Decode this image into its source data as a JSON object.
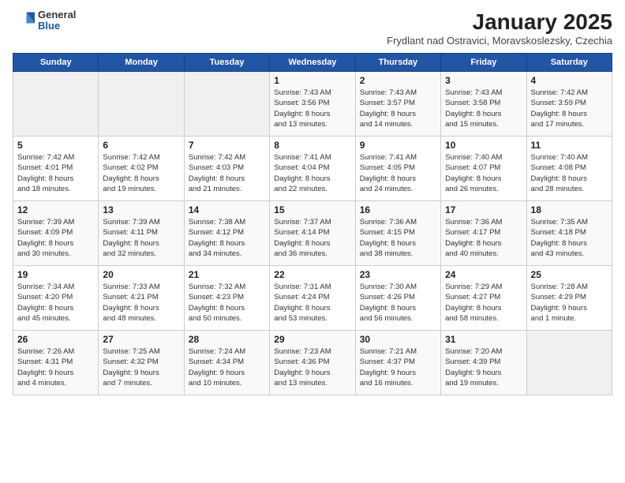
{
  "header": {
    "logo_general": "General",
    "logo_blue": "Blue",
    "month_title": "January 2025",
    "location": "Frydlant nad Ostravici, Moravskoslezsky, Czechia"
  },
  "weekdays": [
    "Sunday",
    "Monday",
    "Tuesday",
    "Wednesday",
    "Thursday",
    "Friday",
    "Saturday"
  ],
  "weeks": [
    [
      {
        "day": "",
        "info": ""
      },
      {
        "day": "",
        "info": ""
      },
      {
        "day": "",
        "info": ""
      },
      {
        "day": "1",
        "info": "Sunrise: 7:43 AM\nSunset: 3:56 PM\nDaylight: 8 hours\nand 13 minutes."
      },
      {
        "day": "2",
        "info": "Sunrise: 7:43 AM\nSunset: 3:57 PM\nDaylight: 8 hours\nand 14 minutes."
      },
      {
        "day": "3",
        "info": "Sunrise: 7:43 AM\nSunset: 3:58 PM\nDaylight: 8 hours\nand 15 minutes."
      },
      {
        "day": "4",
        "info": "Sunrise: 7:42 AM\nSunset: 3:59 PM\nDaylight: 8 hours\nand 17 minutes."
      }
    ],
    [
      {
        "day": "5",
        "info": "Sunrise: 7:42 AM\nSunset: 4:01 PM\nDaylight: 8 hours\nand 18 minutes."
      },
      {
        "day": "6",
        "info": "Sunrise: 7:42 AM\nSunset: 4:02 PM\nDaylight: 8 hours\nand 19 minutes."
      },
      {
        "day": "7",
        "info": "Sunrise: 7:42 AM\nSunset: 4:03 PM\nDaylight: 8 hours\nand 21 minutes."
      },
      {
        "day": "8",
        "info": "Sunrise: 7:41 AM\nSunset: 4:04 PM\nDaylight: 8 hours\nand 22 minutes."
      },
      {
        "day": "9",
        "info": "Sunrise: 7:41 AM\nSunset: 4:05 PM\nDaylight: 8 hours\nand 24 minutes."
      },
      {
        "day": "10",
        "info": "Sunrise: 7:40 AM\nSunset: 4:07 PM\nDaylight: 8 hours\nand 26 minutes."
      },
      {
        "day": "11",
        "info": "Sunrise: 7:40 AM\nSunset: 4:08 PM\nDaylight: 8 hours\nand 28 minutes."
      }
    ],
    [
      {
        "day": "12",
        "info": "Sunrise: 7:39 AM\nSunset: 4:09 PM\nDaylight: 8 hours\nand 30 minutes."
      },
      {
        "day": "13",
        "info": "Sunrise: 7:39 AM\nSunset: 4:11 PM\nDaylight: 8 hours\nand 32 minutes."
      },
      {
        "day": "14",
        "info": "Sunrise: 7:38 AM\nSunset: 4:12 PM\nDaylight: 8 hours\nand 34 minutes."
      },
      {
        "day": "15",
        "info": "Sunrise: 7:37 AM\nSunset: 4:14 PM\nDaylight: 8 hours\nand 36 minutes."
      },
      {
        "day": "16",
        "info": "Sunrise: 7:36 AM\nSunset: 4:15 PM\nDaylight: 8 hours\nand 38 minutes."
      },
      {
        "day": "17",
        "info": "Sunrise: 7:36 AM\nSunset: 4:17 PM\nDaylight: 8 hours\nand 40 minutes."
      },
      {
        "day": "18",
        "info": "Sunrise: 7:35 AM\nSunset: 4:18 PM\nDaylight: 8 hours\nand 43 minutes."
      }
    ],
    [
      {
        "day": "19",
        "info": "Sunrise: 7:34 AM\nSunset: 4:20 PM\nDaylight: 8 hours\nand 45 minutes."
      },
      {
        "day": "20",
        "info": "Sunrise: 7:33 AM\nSunset: 4:21 PM\nDaylight: 8 hours\nand 48 minutes."
      },
      {
        "day": "21",
        "info": "Sunrise: 7:32 AM\nSunset: 4:23 PM\nDaylight: 8 hours\nand 50 minutes."
      },
      {
        "day": "22",
        "info": "Sunrise: 7:31 AM\nSunset: 4:24 PM\nDaylight: 8 hours\nand 53 minutes."
      },
      {
        "day": "23",
        "info": "Sunrise: 7:30 AM\nSunset: 4:26 PM\nDaylight: 8 hours\nand 56 minutes."
      },
      {
        "day": "24",
        "info": "Sunrise: 7:29 AM\nSunset: 4:27 PM\nDaylight: 8 hours\nand 58 minutes."
      },
      {
        "day": "25",
        "info": "Sunrise: 7:28 AM\nSunset: 4:29 PM\nDaylight: 9 hours\nand 1 minute."
      }
    ],
    [
      {
        "day": "26",
        "info": "Sunrise: 7:26 AM\nSunset: 4:31 PM\nDaylight: 9 hours\nand 4 minutes."
      },
      {
        "day": "27",
        "info": "Sunrise: 7:25 AM\nSunset: 4:32 PM\nDaylight: 9 hours\nand 7 minutes."
      },
      {
        "day": "28",
        "info": "Sunrise: 7:24 AM\nSunset: 4:34 PM\nDaylight: 9 hours\nand 10 minutes."
      },
      {
        "day": "29",
        "info": "Sunrise: 7:23 AM\nSunset: 4:36 PM\nDaylight: 9 hours\nand 13 minutes."
      },
      {
        "day": "30",
        "info": "Sunrise: 7:21 AM\nSunset: 4:37 PM\nDaylight: 9 hours\nand 16 minutes."
      },
      {
        "day": "31",
        "info": "Sunrise: 7:20 AM\nSunset: 4:39 PM\nDaylight: 9 hours\nand 19 minutes."
      },
      {
        "day": "",
        "info": ""
      }
    ]
  ]
}
